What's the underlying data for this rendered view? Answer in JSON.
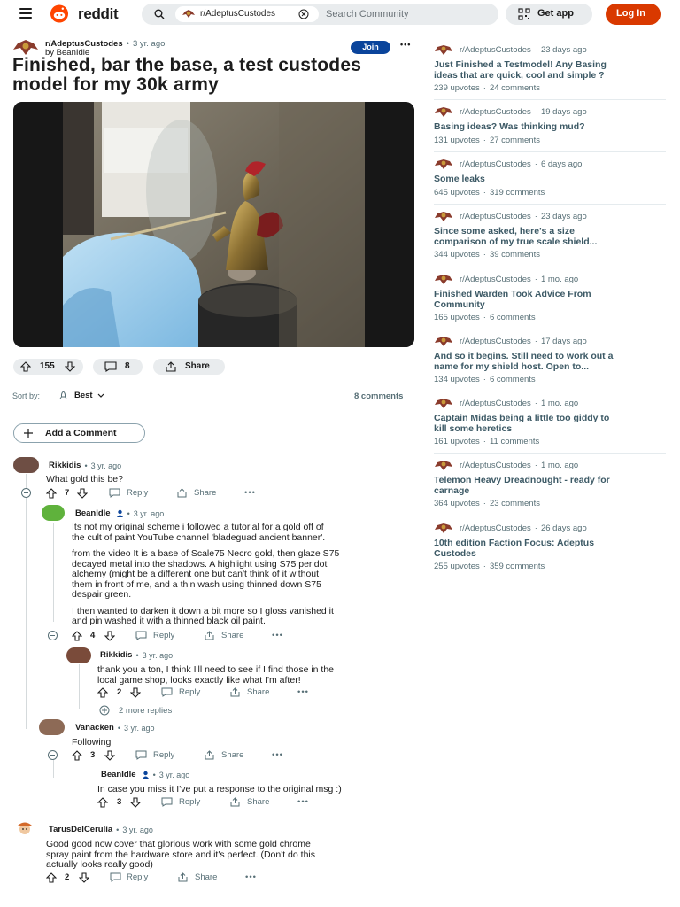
{
  "header": {
    "logo_text": "reddit",
    "search_chip": "r/AdeptusCustodes",
    "search_placeholder": "Search Community",
    "get_app": "Get app",
    "login": "Log In"
  },
  "post": {
    "subreddit": "r/AdeptusCustodes",
    "time": "3 yr. ago",
    "author": "by BeanIdle",
    "join": "Join",
    "more": "•••",
    "title": "Finished, bar the base, a test custodes model for my 30k army",
    "upvotes": "155",
    "comments": "8",
    "share": "Share"
  },
  "sort": {
    "label": "Sort by:",
    "value": "Best",
    "count": "8 comments"
  },
  "add_comment": "Add a Comment",
  "comments": [
    {
      "author": "Rikkidis",
      "time": "3 yr. ago",
      "lines": [
        "What gold this be?"
      ],
      "votes": "7",
      "reply": "Reply",
      "share": "Share"
    },
    {
      "author": "BeanIdle",
      "time": "3 yr. ago",
      "lines": [
        "Its not my original scheme i followed a tutorial for a gold off of",
        "the cult of paint YouTube channel 'bladeguad ancient banner'.",
        "from the video It is a base of Scale75 Necro gold, then glaze S75",
        "decayed metal into the shadows. A highlight using S75 peridot",
        "alchemy (might be a different one but can't think of it without",
        "them in front of me, and a thin wash using thinned down S75",
        "despair green.",
        "I then wanted to darken it down a bit more so I gloss vanished it",
        "and pin washed it with a thinned black oil paint."
      ],
      "votes": "4",
      "reply": "Reply",
      "share": "Share"
    },
    {
      "author": "Rikkidis",
      "time": "3 yr. ago",
      "lines": [
        "thank you a ton, I think I'll need to see if I find those in the",
        "local game shop, looks exactly like what I'm after!"
      ],
      "votes": "2",
      "reply": "Reply",
      "share": "Share",
      "more_replies": "2 more replies"
    },
    {
      "author": "Vanacken",
      "time": "3 yr. ago",
      "lines": [
        "Following"
      ],
      "votes": "3",
      "reply": "Reply",
      "share": "Share"
    },
    {
      "author": "BeanIdle",
      "time": "3 yr. ago",
      "lines": [
        "In case you miss it I've put a response to the original msg :)"
      ],
      "votes": "3",
      "reply": "Reply",
      "share": "Share"
    },
    {
      "author": "TarusDelCerulia",
      "time": "3 yr. ago",
      "lines": [
        "Good good now cover that glorious work with some gold chrome",
        "spray paint from the hardware store and it's perfect. (Don't do this",
        "actually looks really good)"
      ],
      "votes": "2",
      "reply": "Reply",
      "share": "Share"
    }
  ],
  "sidebar": [
    {
      "sub": "r/AdeptusCustodes",
      "time": "23 days ago",
      "title": [
        "Just Finished a Testmodel! Any Basing",
        "ideas that are quick, cool and simple ?"
      ],
      "upvotes": "239 upvotes",
      "comments": "24 comments"
    },
    {
      "sub": "r/AdeptusCustodes",
      "time": "19 days ago",
      "title": [
        "Basing ideas? Was thinking mud?"
      ],
      "upvotes": "131 upvotes",
      "comments": "27 comments"
    },
    {
      "sub": "r/AdeptusCustodes",
      "time": "6 days ago",
      "title": [
        "Some leaks"
      ],
      "upvotes": "645 upvotes",
      "comments": "319 comments"
    },
    {
      "sub": "r/AdeptusCustodes",
      "time": "23 days ago",
      "title": [
        "Since some asked, here's a size",
        "comparison of my true scale shield..."
      ],
      "upvotes": "344 upvotes",
      "comments": "39 comments"
    },
    {
      "sub": "r/AdeptusCustodes",
      "time": "1 mo. ago",
      "title": [
        "Finished Warden Took Advice From",
        "Community"
      ],
      "upvotes": "165 upvotes",
      "comments": "6 comments"
    },
    {
      "sub": "r/AdeptusCustodes",
      "time": "17 days ago",
      "title": [
        "And so it begins. Still need to work out a",
        "name for my shield host. Open to..."
      ],
      "upvotes": "134 upvotes",
      "comments": "6 comments"
    },
    {
      "sub": "r/AdeptusCustodes",
      "time": "1 mo. ago",
      "title": [
        "Captain Midas being a little too giddy to",
        "kill some heretics"
      ],
      "upvotes": "161 upvotes",
      "comments": "11 comments"
    },
    {
      "sub": "r/AdeptusCustodes",
      "time": "1 mo. ago",
      "title": [
        "Telemon Heavy Dreadnought - ready for",
        "carnage"
      ],
      "upvotes": "364 upvotes",
      "comments": "23 comments"
    },
    {
      "sub": "r/AdeptusCustodes",
      "time": "26 days ago",
      "title": [
        "10th edition Faction Focus: Adeptus",
        "Custodes"
      ],
      "upvotes": "255 upvotes",
      "comments": "359 comments"
    }
  ],
  "colors": {
    "brand": "#ff4500",
    "login": "#d93900",
    "join": "#0a449b",
    "sidebar_title": "#3d5a66"
  },
  "icons": [
    "menu-icon",
    "reddit-logo-icon",
    "search-icon",
    "clear-icon",
    "qr-code-icon",
    "upvote-icon",
    "downvote-icon",
    "comment-icon",
    "share-icon",
    "more-icon",
    "plus-icon",
    "mod-badge-icon"
  ]
}
